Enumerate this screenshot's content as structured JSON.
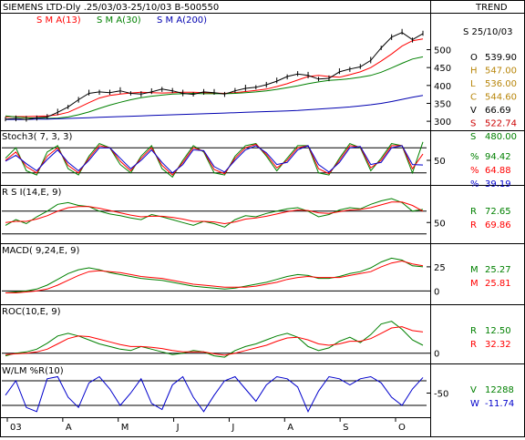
{
  "header": {
    "title": "SIEMENS LTD-Dly .25/03/03-25/10/03  B-500550",
    "trend_label": "TREND",
    "sma13_label": "S M A(13)",
    "sma30_label": "S M A(30)",
    "sma200_label": "S M A(200)",
    "date_label": "S 25/10/03"
  },
  "quote": [
    {
      "key": "O",
      "value": "539.90",
      "color": "#000000"
    },
    {
      "key": "H",
      "value": "547.00",
      "color": "#b8860b"
    },
    {
      "key": "L",
      "value": "536.00",
      "color": "#b8860b"
    },
    {
      "key": "C",
      "value": "544.60",
      "color": "#b8860b"
    },
    {
      "key": "V",
      "value": "66.69",
      "color": "#000000"
    },
    {
      "key": "S",
      "value": "522.74",
      "color": "#cc0000"
    },
    {
      "key": "S",
      "value": "480.00",
      "color": "#008000"
    }
  ],
  "colors": {
    "price": "#000000",
    "sma13": "#ff0000",
    "sma30": "#008000",
    "sma200": "#0000b0",
    "stoch_blue": "#0000cc",
    "green": "#008000",
    "red": "#ff0000",
    "grid": "#000000"
  },
  "chart_data": [
    {
      "type": "line",
      "name": "price",
      "title": "SIEMENS LTD-Dly .25/03/03-25/10/03  B-500550",
      "x_ticks": [
        "03",
        "A",
        "M",
        "J",
        "J",
        "A",
        "S",
        "O"
      ],
      "y_ticks": [
        500,
        450,
        400,
        350,
        300
      ],
      "ylim": [
        285,
        565
      ],
      "series": [
        {
          "name": "S M A(13)",
          "values": [
            312,
            313,
            313,
            314,
            315,
            318,
            325,
            338,
            352,
            365,
            372,
            376,
            379,
            381,
            380,
            379,
            380,
            381,
            381,
            380,
            379,
            378,
            380,
            383,
            386,
            390,
            397,
            405,
            415,
            425,
            428,
            425,
            423,
            430,
            438,
            450,
            468,
            488,
            510,
            525,
            530
          ]
        },
        {
          "name": "S M A(30)",
          "values": [
            315,
            312,
            310,
            309,
            308,
            309,
            312,
            318,
            326,
            336,
            345,
            353,
            360,
            366,
            370,
            373,
            376,
            377,
            378,
            377,
            377,
            377,
            378,
            380,
            382,
            385,
            389,
            394,
            399,
            405,
            410,
            414,
            416,
            419,
            423,
            428,
            437,
            449,
            462,
            474,
            480
          ]
        },
        {
          "name": "S M A(200)",
          "values": [
            305,
            305,
            305,
            306,
            306,
            307,
            308,
            309,
            310,
            311,
            312,
            313,
            314,
            315,
            316,
            317,
            318,
            319,
            320,
            321,
            322,
            323,
            324,
            325,
            326,
            327,
            328,
            329,
            330,
            332,
            334,
            336,
            338,
            340,
            343,
            346,
            350,
            355,
            361,
            367,
            372
          ]
        },
        {
          "name": "Price",
          "values": [
            306,
            308,
            305,
            310,
            312,
            325,
            340,
            360,
            378,
            382,
            380,
            385,
            378,
            376,
            382,
            390,
            385,
            378,
            375,
            382,
            380,
            376,
            385,
            392,
            395,
            402,
            412,
            425,
            432,
            428,
            418,
            420,
            438,
            446,
            452,
            470,
            505,
            535,
            548,
            528,
            545
          ]
        }
      ]
    },
    {
      "type": "line",
      "name": "stochastic",
      "title": "Stoch3( 7, 3, 3)",
      "y_ticks": [
        50
      ],
      "ylim": [
        0,
        100
      ],
      "series": [
        {
          "name": "%K",
          "values": [
            55,
            80,
            25,
            15,
            70,
            85,
            30,
            15,
            60,
            90,
            80,
            40,
            20,
            60,
            85,
            30,
            10,
            50,
            85,
            70,
            20,
            15,
            60,
            85,
            90,
            60,
            25,
            55,
            85,
            85,
            20,
            15,
            55,
            90,
            80,
            25,
            55,
            90,
            85,
            20,
            94
          ]
        },
        {
          "name": "%D",
          "values": [
            50,
            70,
            35,
            20,
            60,
            80,
            38,
            20,
            55,
            85,
            80,
            48,
            25,
            55,
            80,
            38,
            15,
            45,
            80,
            72,
            28,
            18,
            55,
            80,
            88,
            64,
            32,
            50,
            80,
            85,
            30,
            18,
            50,
            85,
            82,
            32,
            50,
            85,
            85,
            30,
            65
          ]
        },
        {
          "name": "%D2",
          "values": [
            48,
            62,
            42,
            25,
            52,
            75,
            45,
            25,
            50,
            80,
            80,
            55,
            30,
            50,
            75,
            45,
            20,
            40,
            75,
            73,
            35,
            22,
            50,
            75,
            85,
            68,
            40,
            45,
            75,
            85,
            40,
            22,
            45,
            80,
            83,
            40,
            45,
            80,
            85,
            40,
            39
          ]
        }
      ],
      "labels": [
        {
          "key": "%",
          "value": "94.42"
        },
        {
          "key": "%",
          "value": "64.88"
        },
        {
          "key": "%",
          "value": "39.19"
        }
      ]
    },
    {
      "type": "line",
      "name": "rsi",
      "title": "R S I(14,E, 9)",
      "y_ticks": [
        50
      ],
      "ylim": [
        20,
        100
      ],
      "series": [
        {
          "name": "RSI",
          "values": [
            45,
            55,
            48,
            60,
            70,
            82,
            85,
            80,
            78,
            70,
            65,
            62,
            58,
            55,
            64,
            60,
            55,
            50,
            45,
            52,
            48,
            42,
            55,
            62,
            60,
            66,
            70,
            74,
            76,
            70,
            60,
            64,
            72,
            76,
            74,
            82,
            88,
            92,
            85,
            70,
            73
          ]
        },
        {
          "name": "Signal",
          "values": [
            50,
            52,
            52,
            56,
            62,
            70,
            76,
            78,
            78,
            75,
            71,
            67,
            63,
            60,
            61,
            61,
            59,
            56,
            52,
            52,
            51,
            48,
            51,
            56,
            58,
            61,
            65,
            69,
            72,
            71,
            67,
            66,
            69,
            72,
            73,
            76,
            81,
            86,
            86,
            80,
            70
          ]
        }
      ],
      "labels": [
        {
          "key": "R",
          "value": "72.65"
        },
        {
          "key": "R",
          "value": "69.86"
        }
      ]
    },
    {
      "type": "line",
      "name": "macd",
      "title": "MACD( 9,24,E, 9)",
      "y_ticks": [
        25,
        0
      ],
      "ylim": [
        -10,
        40
      ],
      "series": [
        {
          "name": "MACD",
          "values": [
            -2,
            -1,
            0,
            2,
            6,
            12,
            18,
            22,
            24,
            22,
            19,
            17,
            15,
            13,
            12,
            11,
            9,
            7,
            5,
            4,
            3,
            2,
            3,
            5,
            7,
            9,
            12,
            15,
            17,
            16,
            13,
            13,
            15,
            18,
            20,
            24,
            30,
            34,
            32,
            26,
            25
          ]
        },
        {
          "name": "Signal",
          "values": [
            -2,
            -2,
            -1,
            0,
            2,
            6,
            11,
            16,
            20,
            21,
            20,
            19,
            17,
            15,
            14,
            13,
            11,
            9,
            7,
            6,
            5,
            4,
            4,
            4,
            5,
            7,
            9,
            12,
            14,
            15,
            14,
            14,
            14,
            16,
            18,
            20,
            25,
            29,
            31,
            28,
            26
          ]
        }
      ],
      "labels": [
        {
          "key": "M",
          "value": "25.27"
        },
        {
          "key": "M",
          "value": "25.81"
        }
      ]
    },
    {
      "type": "line",
      "name": "roc",
      "title": "ROC(10,E, 9)",
      "y_ticks": [
        0
      ],
      "ylim": [
        -10,
        60
      ],
      "series": [
        {
          "name": "ROC",
          "values": [
            -4,
            0,
            2,
            6,
            15,
            26,
            30,
            26,
            20,
            14,
            10,
            6,
            4,
            10,
            6,
            2,
            -2,
            0,
            4,
            2,
            -4,
            -6,
            4,
            10,
            14,
            20,
            26,
            30,
            24,
            10,
            4,
            8,
            18,
            24,
            16,
            28,
            44,
            48,
            36,
            20,
            12
          ]
        },
        {
          "name": "Signal",
          "values": [
            -2,
            -1,
            0,
            2,
            6,
            14,
            22,
            26,
            25,
            21,
            17,
            13,
            10,
            10,
            9,
            7,
            4,
            2,
            2,
            2,
            -1,
            -3,
            0,
            4,
            8,
            12,
            18,
            23,
            24,
            20,
            14,
            12,
            14,
            18,
            18,
            22,
            30,
            38,
            40,
            34,
            32
          ]
        }
      ],
      "labels": [
        {
          "key": "R",
          "value": "12.50"
        },
        {
          "key": "R",
          "value": "32.32"
        }
      ]
    },
    {
      "type": "line",
      "name": "williams",
      "title": "W/LM %R(10)",
      "y_ticks": [
        -50
      ],
      "ylim": [
        -100,
        0
      ],
      "series": [
        {
          "name": "%R",
          "values": [
            -55,
            -20,
            -85,
            -95,
            -15,
            -10,
            -60,
            -85,
            -25,
            -10,
            -40,
            -80,
            -50,
            -15,
            -75,
            -90,
            -30,
            -10,
            -60,
            -95,
            -55,
            -20,
            -10,
            -40,
            -70,
            -30,
            -10,
            -15,
            -35,
            -95,
            -45,
            -10,
            -15,
            -30,
            -15,
            -10,
            -25,
            -60,
            -80,
            -40,
            -12
          ]
        }
      ],
      "labels": [
        {
          "key": "V",
          "value": "12288"
        },
        {
          "key": "W",
          "value": "-11.74"
        }
      ]
    }
  ]
}
